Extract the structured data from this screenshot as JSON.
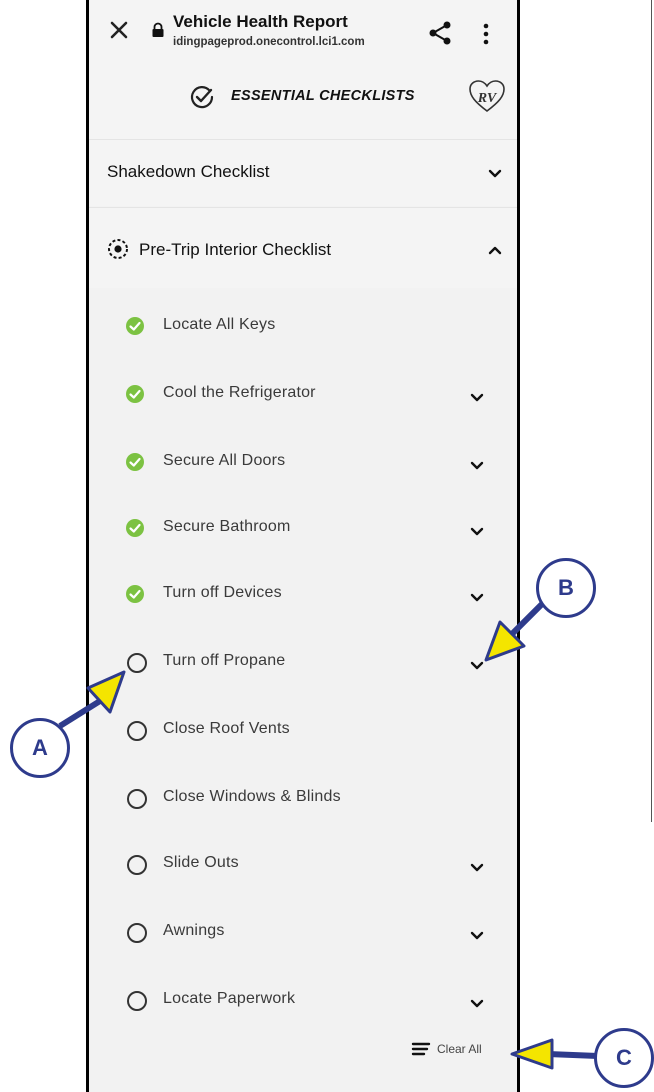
{
  "browser": {
    "title": "Vehicle Health Report",
    "host": "idingpageprod.onecontrol.lci1.com",
    "icons": [
      "close-icon",
      "lock-icon",
      "share-icon",
      "more-vert-icon"
    ]
  },
  "brand": {
    "title": "ESSENTIAL CHECKLISTS",
    "icons": [
      "check-circle-icon",
      "rv-logo"
    ]
  },
  "sections": {
    "shakedown": "Shakedown Checklist",
    "pretrip": "Pre-Trip Interior Checklist"
  },
  "items": [
    {
      "label": "Locate All Keys",
      "checked": true,
      "expandable": false
    },
    {
      "label": "Cool the Refrigerator",
      "checked": true,
      "expandable": true
    },
    {
      "label": "Secure All Doors",
      "checked": true,
      "expandable": true
    },
    {
      "label": "Secure Bathroom",
      "checked": true,
      "expandable": true
    },
    {
      "label": "Turn off Devices",
      "checked": true,
      "expandable": true
    },
    {
      "label": "Turn off Propane",
      "checked": false,
      "expandable": true
    },
    {
      "label": "Close Roof Vents",
      "checked": false,
      "expandable": false
    },
    {
      "label": "Close Windows & Blinds",
      "checked": false,
      "expandable": false
    },
    {
      "label": "Slide Outs",
      "checked": false,
      "expandable": true
    },
    {
      "label": "Awnings",
      "checked": false,
      "expandable": true
    },
    {
      "label": "Locate Paperwork",
      "checked": false,
      "expandable": true
    }
  ],
  "clear_all": "Clear All",
  "callouts": {
    "a": "A",
    "b": "B",
    "c": "C"
  },
  "colors": {
    "accent_green": "#7cc242",
    "callout_blue": "#2e3b8c",
    "arrow_yellow": "#f4e500"
  }
}
